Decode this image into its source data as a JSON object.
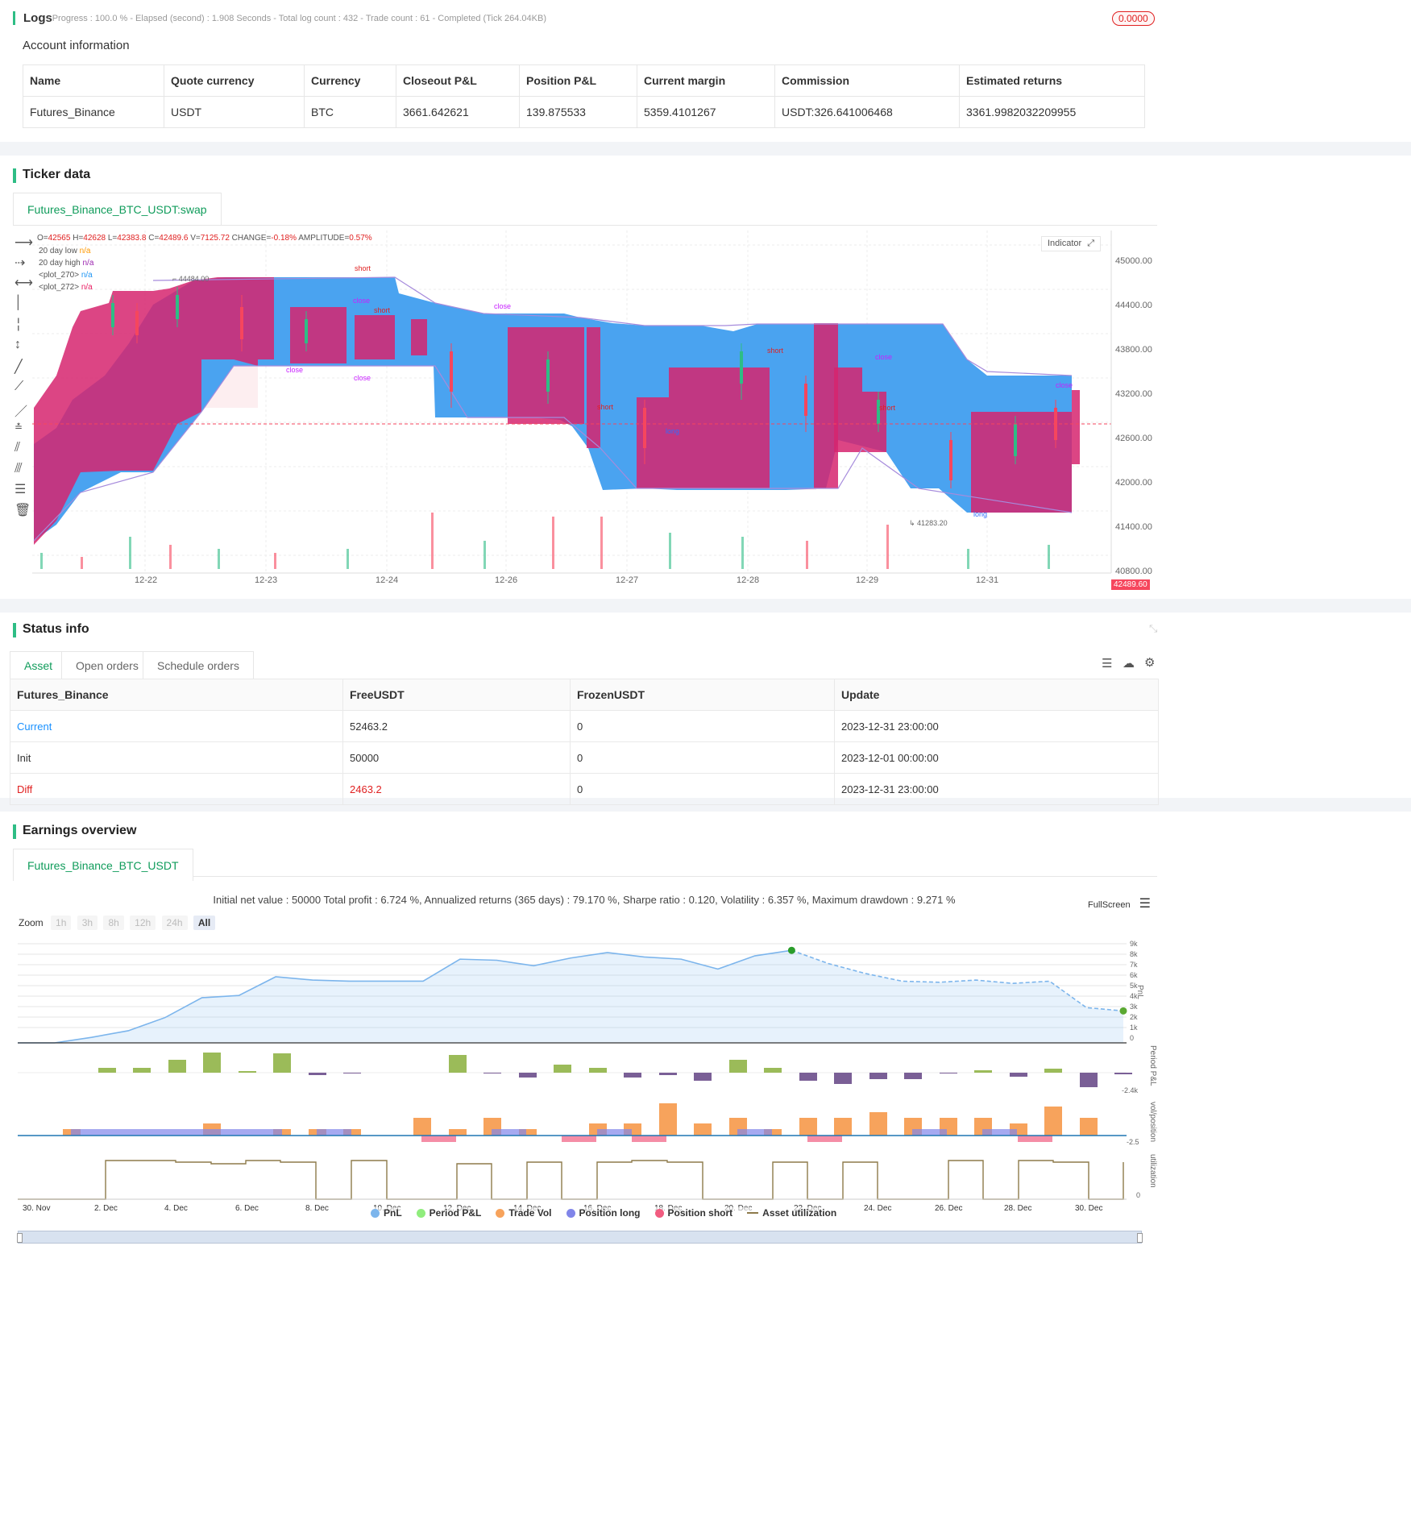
{
  "logs": {
    "title": "Logs",
    "summary": "- Progress : 100.0 % - Elapsed (second) : 1.908  Seconds - Total log count : 432 - Trade count : 61 - Completed (Tick 264.04KB)",
    "badge": "0.0000",
    "account_title": "Account information",
    "account_headers": [
      "Name",
      "Quote currency",
      "Currency",
      "Closeout P&L",
      "Position P&L",
      "Current margin",
      "Commission",
      "Estimated returns"
    ],
    "account_row": [
      "Futures_Binance",
      "USDT",
      "BTC",
      "3661.642621",
      "139.875533",
      "5359.4101267",
      "USDT:326.641006468",
      "3361.9982032209955"
    ]
  },
  "ticker": {
    "title": "Ticker data",
    "tab": "Futures_Binance_BTC_USDT:swap",
    "ohlc": {
      "O": "42565",
      "H": "42628",
      "L": "42383.8",
      "C": "42489.6",
      "V": "7125.72",
      "CHANGE": "-0.18%",
      "AMPLITUDE": "0.57%"
    },
    "indicators": [
      {
        "name": "20 day low",
        "value": "n/a",
        "color": "#ff9800"
      },
      {
        "name": "20 day high",
        "value": "n/a",
        "color": "#9c27b0"
      },
      {
        "name": "<plot_270>",
        "value": "n/a",
        "color": "#2196f3"
      },
      {
        "name": "<plot_272>",
        "value": "n/a",
        "color": "#e91e63"
      }
    ],
    "indicator_button": "Indicator",
    "price_axis": [
      "45000.00",
      "44400.00",
      "43800.00",
      "43200.00",
      "42600.00",
      "42000.00",
      "41400.00",
      "40800.00"
    ],
    "current_price": "42489.60",
    "high_label": "44484.00",
    "low_label": "41283.20",
    "dates": [
      "12-22",
      "12-23",
      "12-24",
      "12-26",
      "12-27",
      "12-28",
      "12-29",
      "12-31"
    ],
    "signals": [
      "short",
      "close",
      "long"
    ]
  },
  "status": {
    "title": "Status info",
    "tabs": [
      "Asset",
      "Open orders",
      "Schedule orders"
    ],
    "headers": [
      "Futures_Binance",
      "FreeUSDT",
      "FrozenUSDT",
      "Update"
    ],
    "rows": [
      {
        "label": "Current",
        "free": "52463.2",
        "frozen": "0",
        "update": "2023-12-31 23:00:00",
        "color": "#1890ff"
      },
      {
        "label": "Init",
        "free": "50000",
        "frozen": "0",
        "update": "2023-12-01 00:00:00",
        "color": "#333333"
      },
      {
        "label": "Diff",
        "free": "2463.2",
        "frozen": "0",
        "update": "2023-12-31 23:00:00",
        "color": "#e02020"
      }
    ]
  },
  "earnings": {
    "title": "Earnings overview",
    "tab": "Futures_Binance_BTC_USDT",
    "summary": "Initial net value : 50000 Total profit : 6.724 %, Annualized returns (365 days) : 79.170 %, Sharpe ratio : 0.120, Volatility : 6.357 %, Maximum drawdown : 9.271 %",
    "fullscreen": "FullScreen",
    "zoom_label": "Zoom",
    "zoom_buttons": [
      "1h",
      "3h",
      "8h",
      "12h",
      "24h",
      "All"
    ],
    "pnl_axis": [
      "9k",
      "8k",
      "7k",
      "6k",
      "5k",
      "4k",
      "3k",
      "2k",
      "1k",
      "0"
    ],
    "period_axis": "-2.4k",
    "vol_axis": "-2.5",
    "util_axis": "0",
    "axis_titles": [
      "PnL",
      "Period P&L",
      "vol/position",
      "utilization"
    ],
    "x_dates": [
      "30. Nov",
      "2. Dec",
      "4. Dec",
      "6. Dec",
      "8. Dec",
      "10. Dec",
      "12. Dec",
      "14. Dec",
      "16. Dec",
      "18. Dec",
      "20. Dec",
      "22. Dec",
      "24. Dec",
      "26. Dec",
      "28. Dec",
      "30. Dec"
    ],
    "legend": [
      {
        "name": "PnL",
        "color": "#7cb5ec"
      },
      {
        "name": "Period P&L",
        "color": "#90ed7d"
      },
      {
        "name": "Trade Vol",
        "color": "#f7a35c"
      },
      {
        "name": "Position long",
        "color": "#8085e9"
      },
      {
        "name": "Position short",
        "color": "#f15c80"
      },
      {
        "name": "Asset utilization",
        "color": "#8d7a4a"
      }
    ]
  },
  "chart_data": {
    "type": "line",
    "series": [
      {
        "name": "PnL",
        "x": [
          "30. Nov",
          "2. Dec",
          "3. Dec",
          "4. Dec",
          "5. Dec",
          "6. Dec",
          "7. Dec",
          "8. Dec",
          "9. Dec",
          "10. Dec",
          "11. Dec",
          "12. Dec",
          "13. Dec",
          "14. Dec",
          "15. Dec",
          "16. Dec",
          "17. Dec",
          "18. Dec",
          "19. Dec",
          "20. Dec",
          "21. Dec",
          "22. Dec",
          "23. Dec",
          "24. Dec",
          "25. Dec",
          "26. Dec",
          "27. Dec",
          "28. Dec",
          "29. Dec",
          "30. Dec",
          "31. Dec"
        ],
        "values": [
          0,
          0,
          500,
          1100,
          2300,
          4100,
          4300,
          6000,
          5700,
          5600,
          5600,
          5600,
          7600,
          7500,
          7000,
          7700,
          8200,
          7800,
          7600,
          6700,
          7900,
          8400,
          7200,
          6300,
          5600,
          5500,
          5700,
          5400,
          5600,
          3200,
          2900
        ]
      }
    ],
    "ylim": [
      0,
      9000
    ]
  }
}
